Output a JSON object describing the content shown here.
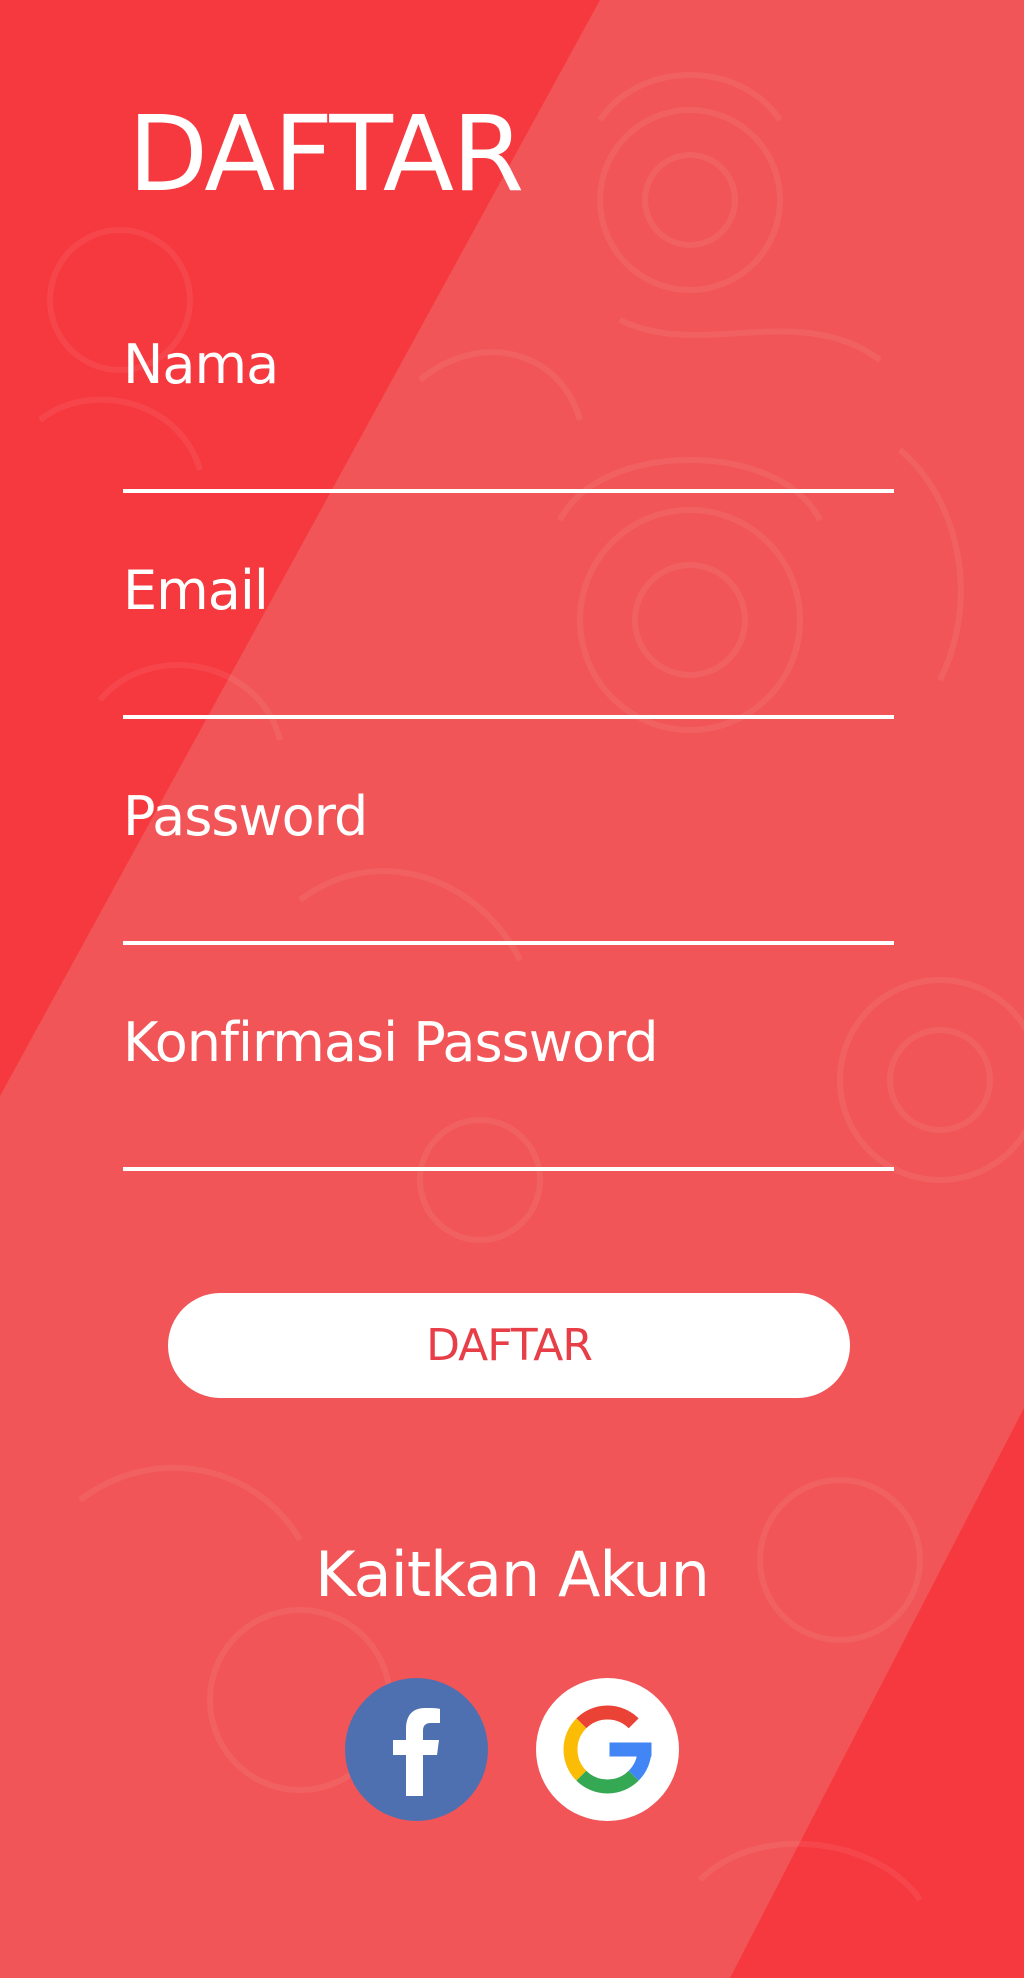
{
  "page": {
    "title": "DAFTAR"
  },
  "form": {
    "fields": [
      {
        "label": "Nama",
        "value": ""
      },
      {
        "label": "Email",
        "value": ""
      },
      {
        "label": "Password",
        "value": ""
      },
      {
        "label": "Konfirmasi Password",
        "value": ""
      }
    ],
    "submit_label": "DAFTAR"
  },
  "social": {
    "heading": "Kaitkan Akun",
    "buttons": [
      {
        "icon": "facebook-icon",
        "color": "#4f70b0"
      },
      {
        "icon": "google-icon",
        "color": "#ffffff"
      }
    ]
  },
  "colors": {
    "background": "#f6393e",
    "background_band": "#f15557",
    "accent_text": "#e83e47"
  }
}
